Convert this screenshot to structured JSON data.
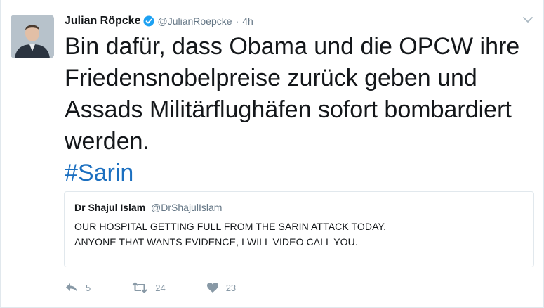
{
  "tweet": {
    "display_name": "Julian Röpcke",
    "handle": "@JulianRoepcke",
    "separator": "·",
    "time": "4h",
    "text": "Bin dafür, dass Obama und die OPCW ihre Friedensnobelpreise zurück geben und Assads Militärflughäfen sofort bombardiert werden.",
    "hashtag": "#Sarin"
  },
  "quoted_tweet": {
    "display_name": "Dr Shajul Islam",
    "handle": "@DrShajulIslam",
    "text_line1": "OUR HOSPITAL GETTING FULL FROM THE SARIN ATTACK TODAY.",
    "text_line2": "ANYONE THAT WANTS EVIDENCE, I WILL VIDEO CALL YOU."
  },
  "actions": {
    "reply_count": "5",
    "retweet_count": "24",
    "like_count": "23"
  },
  "colors": {
    "hashtag": "#1b6fc0",
    "verified": "#1da1f2",
    "secondary_text": "#657786",
    "action_icons": "#8899a6"
  },
  "icons": [
    "verified-icon",
    "chevron-down-icon",
    "reply-icon",
    "retweet-icon",
    "like-icon"
  ]
}
